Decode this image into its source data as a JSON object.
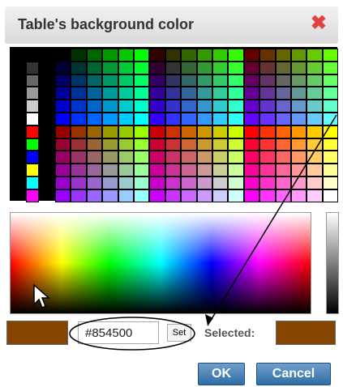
{
  "dialog": {
    "title": "Table's background color",
    "close_icon": "close-icon",
    "close_color": "#e04040"
  },
  "palette": {
    "grays": [
      "#000000",
      "#333333",
      "#666666",
      "#999999",
      "#cccccc",
      "#ffffff",
      "#ff0000",
      "#00ff00",
      "#0000ff",
      "#ffff00",
      "#00ffff",
      "#ff00ff"
    ]
  },
  "picker": {
    "current_color": "#854500",
    "hex_value": "#854500",
    "set_label": "Set",
    "selected_label": "Selected:",
    "selected_color": "#854500"
  },
  "buttons": {
    "ok_label": "OK",
    "cancel_label": "Cancel"
  }
}
